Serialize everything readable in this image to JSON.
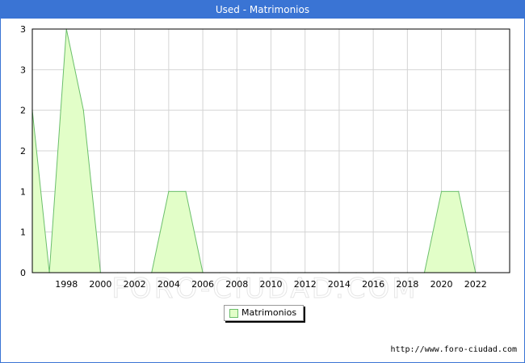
{
  "title": "Used - Matrimonios",
  "source_url": "http://www.foro-ciudad.com",
  "watermark": "FORO-CIUDAD.COM",
  "colors": {
    "title_bar": "#3a74d4",
    "area_fill": "#e2fec8",
    "area_line": "#6bbf6b",
    "grid": "#d4d4d4"
  },
  "chart_data": {
    "type": "area",
    "title": "Used - Matrimonios",
    "xlabel": "",
    "ylabel": "",
    "x": [
      1996,
      1997,
      1998,
      1999,
      2000,
      2001,
      2002,
      2003,
      2004,
      2005,
      2006,
      2007,
      2008,
      2009,
      2010,
      2011,
      2012,
      2013,
      2014,
      2015,
      2016,
      2017,
      2018,
      2019,
      2020,
      2021,
      2022
    ],
    "series": [
      {
        "name": "Matrimonios",
        "values": [
          2,
          0,
          3,
          2,
          0,
          0,
          0,
          0,
          1,
          1,
          0,
          0,
          0,
          0,
          0,
          0,
          0,
          0,
          0,
          0,
          0,
          0,
          0,
          0,
          1,
          1,
          0
        ]
      }
    ],
    "xlim": [
      1996,
      2024
    ],
    "ylim": [
      0,
      3
    ],
    "x_ticks": [
      "1998",
      "2000",
      "2002",
      "2004",
      "2006",
      "2008",
      "2010",
      "2012",
      "2014",
      "2016",
      "2018",
      "2020",
      "2022"
    ],
    "y_ticks": [
      "0",
      "1",
      "1",
      "2",
      "2",
      "3",
      "3"
    ],
    "grid": true,
    "legend_position": "bottom-center"
  }
}
